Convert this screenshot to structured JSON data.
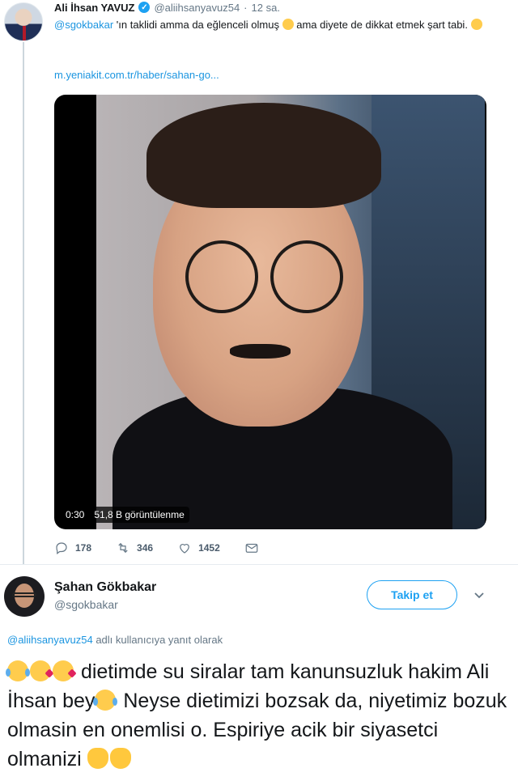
{
  "tweet1": {
    "author_name": "Ali İhsan YAVUZ",
    "handle": "@aliihsanyavuz54",
    "separator": "·",
    "time": "12 sa.",
    "text_mention": "@sgokbakar",
    "text_part1": " 'ın taklidi amma da eğlenceli olmuş ",
    "text_part2": " ama diyete de dikkat etmek şart tabi. ",
    "link": "m.yeniakit.com.tr/haber/sahan-go...",
    "video": {
      "duration": "0:30",
      "views": "51,8 B görüntülenme"
    },
    "actions": {
      "replies": "178",
      "retweets": "346",
      "likes": "1452"
    }
  },
  "tweet2": {
    "author_name": "Şahan Gökbakar",
    "handle": "@sgokbakar",
    "follow_label": "Takip et",
    "reply_mention": "@aliihsanyavuz54",
    "reply_suffix": " adlı kullanıcıya yanıt olarak",
    "text_part1": " dietimde su siralar tam kanunsuzluk hakim Ali İhsan bey",
    "text_part2": " Neyse dietimizi bozsak da, niyetimiz bozuk olmasin en onemlisi o. Espiriye acik bir siyasetci olmanizi "
  },
  "colors": {
    "accent": "#1da1f2",
    "link": "#1b95e0",
    "muted": "#657786"
  },
  "icons": [
    "verified-badge-icon",
    "reply-icon",
    "retweet-icon",
    "like-icon",
    "message-icon",
    "chevron-down-icon",
    "laughing-emoji",
    "wink-emoji",
    "kiss-emoji",
    "clap-emoji"
  ]
}
